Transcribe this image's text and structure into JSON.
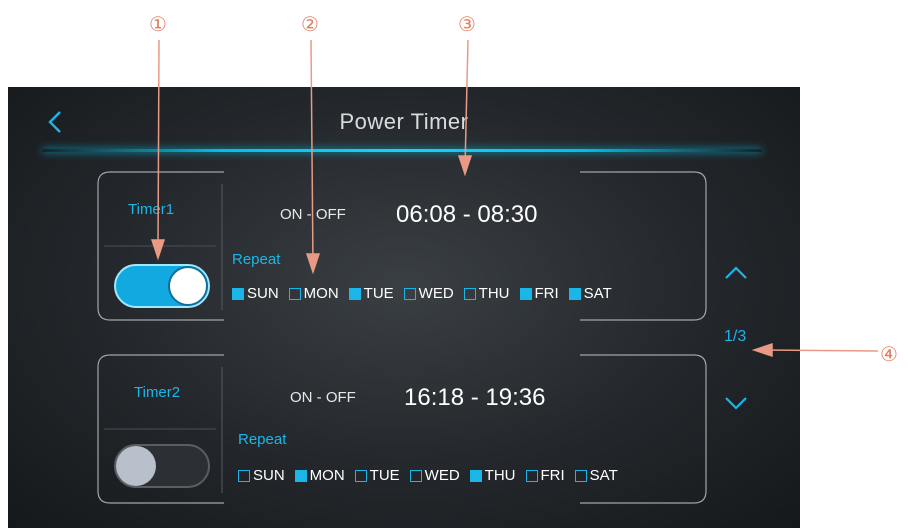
{
  "header": {
    "title": "Power Timer",
    "back_icon": "chevron-left-icon"
  },
  "timers": [
    {
      "name": "Timer1",
      "enabled": true,
      "onoff_label": "ON - OFF",
      "time_range": "06:08 - 08:30",
      "repeat_label": "Repeat",
      "days": [
        {
          "label": "SUN",
          "checked": true
        },
        {
          "label": "MON",
          "checked": false
        },
        {
          "label": "TUE",
          "checked": true
        },
        {
          "label": "WED",
          "checked": false
        },
        {
          "label": "THU",
          "checked": false
        },
        {
          "label": "FRI",
          "checked": true
        },
        {
          "label": "SAT",
          "checked": true
        }
      ]
    },
    {
      "name": "Timer2",
      "enabled": false,
      "onoff_label": "ON - OFF",
      "time_range": "16:18 - 19:36",
      "repeat_label": "Repeat",
      "days": [
        {
          "label": "SUN",
          "checked": false
        },
        {
          "label": "MON",
          "checked": true
        },
        {
          "label": "TUE",
          "checked": false
        },
        {
          "label": "WED",
          "checked": false
        },
        {
          "label": "THU",
          "checked": true
        },
        {
          "label": "FRI",
          "checked": false
        },
        {
          "label": "SAT",
          "checked": false
        }
      ]
    }
  ],
  "pager": {
    "text": "1/3",
    "up_icon": "chevron-up-icon",
    "down_icon": "chevron-down-icon"
  },
  "annotations": [
    "①",
    "②",
    "③",
    "④"
  ],
  "colors": {
    "accent": "#1ab6e8",
    "annotation": "#e47f62",
    "background": "#23272b"
  }
}
